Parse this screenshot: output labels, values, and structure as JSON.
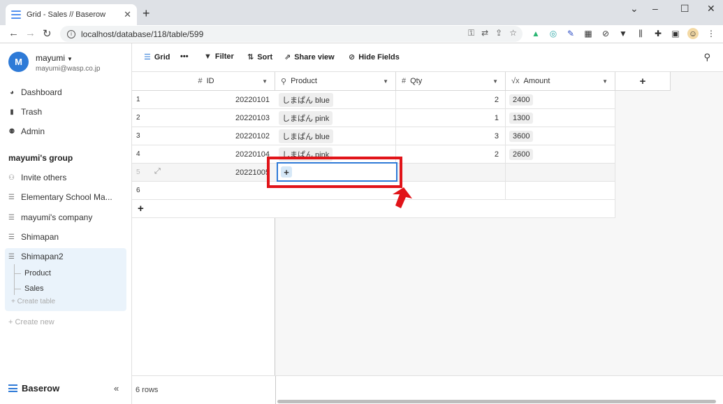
{
  "browser": {
    "tab_title": "Grid - Sales // Baserow",
    "tab_close": "✕",
    "new_tab": "+",
    "url": "localhost/database/118/table/599",
    "window_controls": {
      "minimize": "–",
      "maximize": "☐",
      "close": "✕",
      "chevron": "⌄"
    },
    "nav": {
      "back": "←",
      "forward": "→",
      "reload": "↻"
    }
  },
  "user": {
    "initial": "M",
    "name": "mayumi",
    "email": "mayumi@wasp.co.jp"
  },
  "sidebar": {
    "nav": [
      {
        "label": "Dashboard",
        "icon": "dashboard-icon",
        "glyph": "◕"
      },
      {
        "label": "Trash",
        "icon": "trash-icon",
        "glyph": "🗑"
      },
      {
        "label": "Admin",
        "icon": "admin-icon",
        "glyph": "👥"
      }
    ],
    "group_title": "mayumi's group",
    "invite": "Invite others",
    "databases": [
      {
        "label": "Elementary School Ma..."
      },
      {
        "label": "mayumi's company"
      },
      {
        "label": "Shimapan"
      },
      {
        "label": "Shimapan2"
      }
    ],
    "tables": [
      {
        "label": "Product"
      },
      {
        "label": "Sales"
      }
    ],
    "create_table": "+ Create table",
    "create_new": "+ Create new",
    "brand": "Baserow",
    "collapse": "«"
  },
  "toolbar": {
    "view": "Grid",
    "more": "•••",
    "filter": "Filter",
    "sort": "Sort",
    "share": "Share view",
    "hide": "Hide Fields"
  },
  "grid": {
    "columns": [
      {
        "label": "ID",
        "type": "#"
      },
      {
        "label": "Product",
        "type": "🔗"
      },
      {
        "label": "Qty",
        "type": "#"
      },
      {
        "label": "Amount",
        "type": "√x"
      }
    ],
    "add_column": "+",
    "rows": [
      {
        "n": "1",
        "id": "20220101",
        "product": "しまぱん blue",
        "qty": "2",
        "amount": "2400"
      },
      {
        "n": "2",
        "id": "20220103",
        "product": "しまぱん pink",
        "qty": "1",
        "amount": "1300"
      },
      {
        "n": "3",
        "id": "20220102",
        "product": "しまぱん blue",
        "qty": "3",
        "amount": "3600"
      },
      {
        "n": "4",
        "id": "20220104",
        "product": "しまぱん pink",
        "qty": "2",
        "amount": "2600"
      },
      {
        "n": "5",
        "id": "20221005",
        "product": "",
        "qty": "",
        "amount": ""
      },
      {
        "n": "6",
        "id": "",
        "product": "",
        "qty": "",
        "amount": ""
      }
    ],
    "add_row": "+",
    "selected_cell_add": "+",
    "row_count": "6 rows"
  }
}
